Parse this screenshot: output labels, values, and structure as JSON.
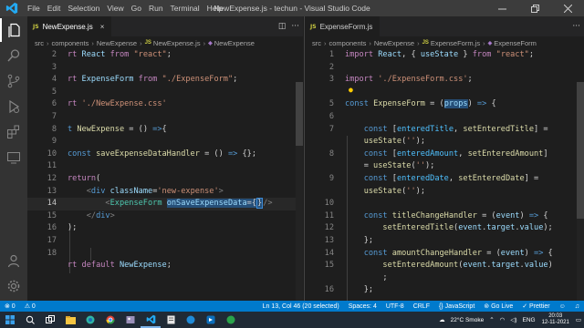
{
  "titlebar": {
    "menu": [
      "File",
      "Edit",
      "Selection",
      "View",
      "Go",
      "Run",
      "Terminal",
      "Help"
    ],
    "title": "NewExpense.js - techun - Visual Studio Code"
  },
  "activity_icons": [
    "explorer-icon",
    "search-icon",
    "source-control-icon",
    "run-debug-icon",
    "extensions-icon",
    "remote-icon",
    "account-icon",
    "settings-gear-icon"
  ],
  "left_editor": {
    "tab": {
      "badge": "JS",
      "label": "NewExpense.js",
      "close": "×"
    },
    "breadcrumb": [
      "src",
      "components",
      "NewExpense",
      "NewExpense.js",
      "NewExpense"
    ],
    "line_numbers": [
      "2",
      "3",
      "4",
      "5",
      "6",
      "7",
      "8",
      "9",
      "10",
      "11",
      "12",
      "13",
      "14",
      "15",
      "16",
      "17",
      "18"
    ],
    "current_line": "13"
  },
  "right_editor": {
    "tab": {
      "badge": "JS",
      "label": "ExpenseForm.js"
    },
    "breadcrumb": [
      "src",
      "components",
      "NewExpense",
      "ExpenseForm.js",
      "ExpenseForm"
    ],
    "line_numbers": [
      "1",
      "2",
      "3",
      "",
      "5",
      "6",
      "7",
      "",
      "8",
      "",
      "9",
      "",
      "10",
      "11",
      "12",
      "13",
      "14",
      "15",
      "",
      "16"
    ]
  },
  "statusbar": {
    "remote": "⊗ 0",
    "warnings": "⚠ 0",
    "position": "Ln 13, Col 46 (20 selected)",
    "spaces": "Spaces: 4",
    "encoding": "UTF-8",
    "eol": "CRLF",
    "language": "{} JavaScript",
    "golive": "⊚ Go Live",
    "prettier": "✓ Prettier"
  },
  "taskbar": {
    "weather": "22°C Smoke",
    "lang": "ENG",
    "time": "20:03",
    "date": "12-11-2021"
  },
  "colors": {
    "statusbar": "#007acc",
    "accent": "#264f78"
  }
}
